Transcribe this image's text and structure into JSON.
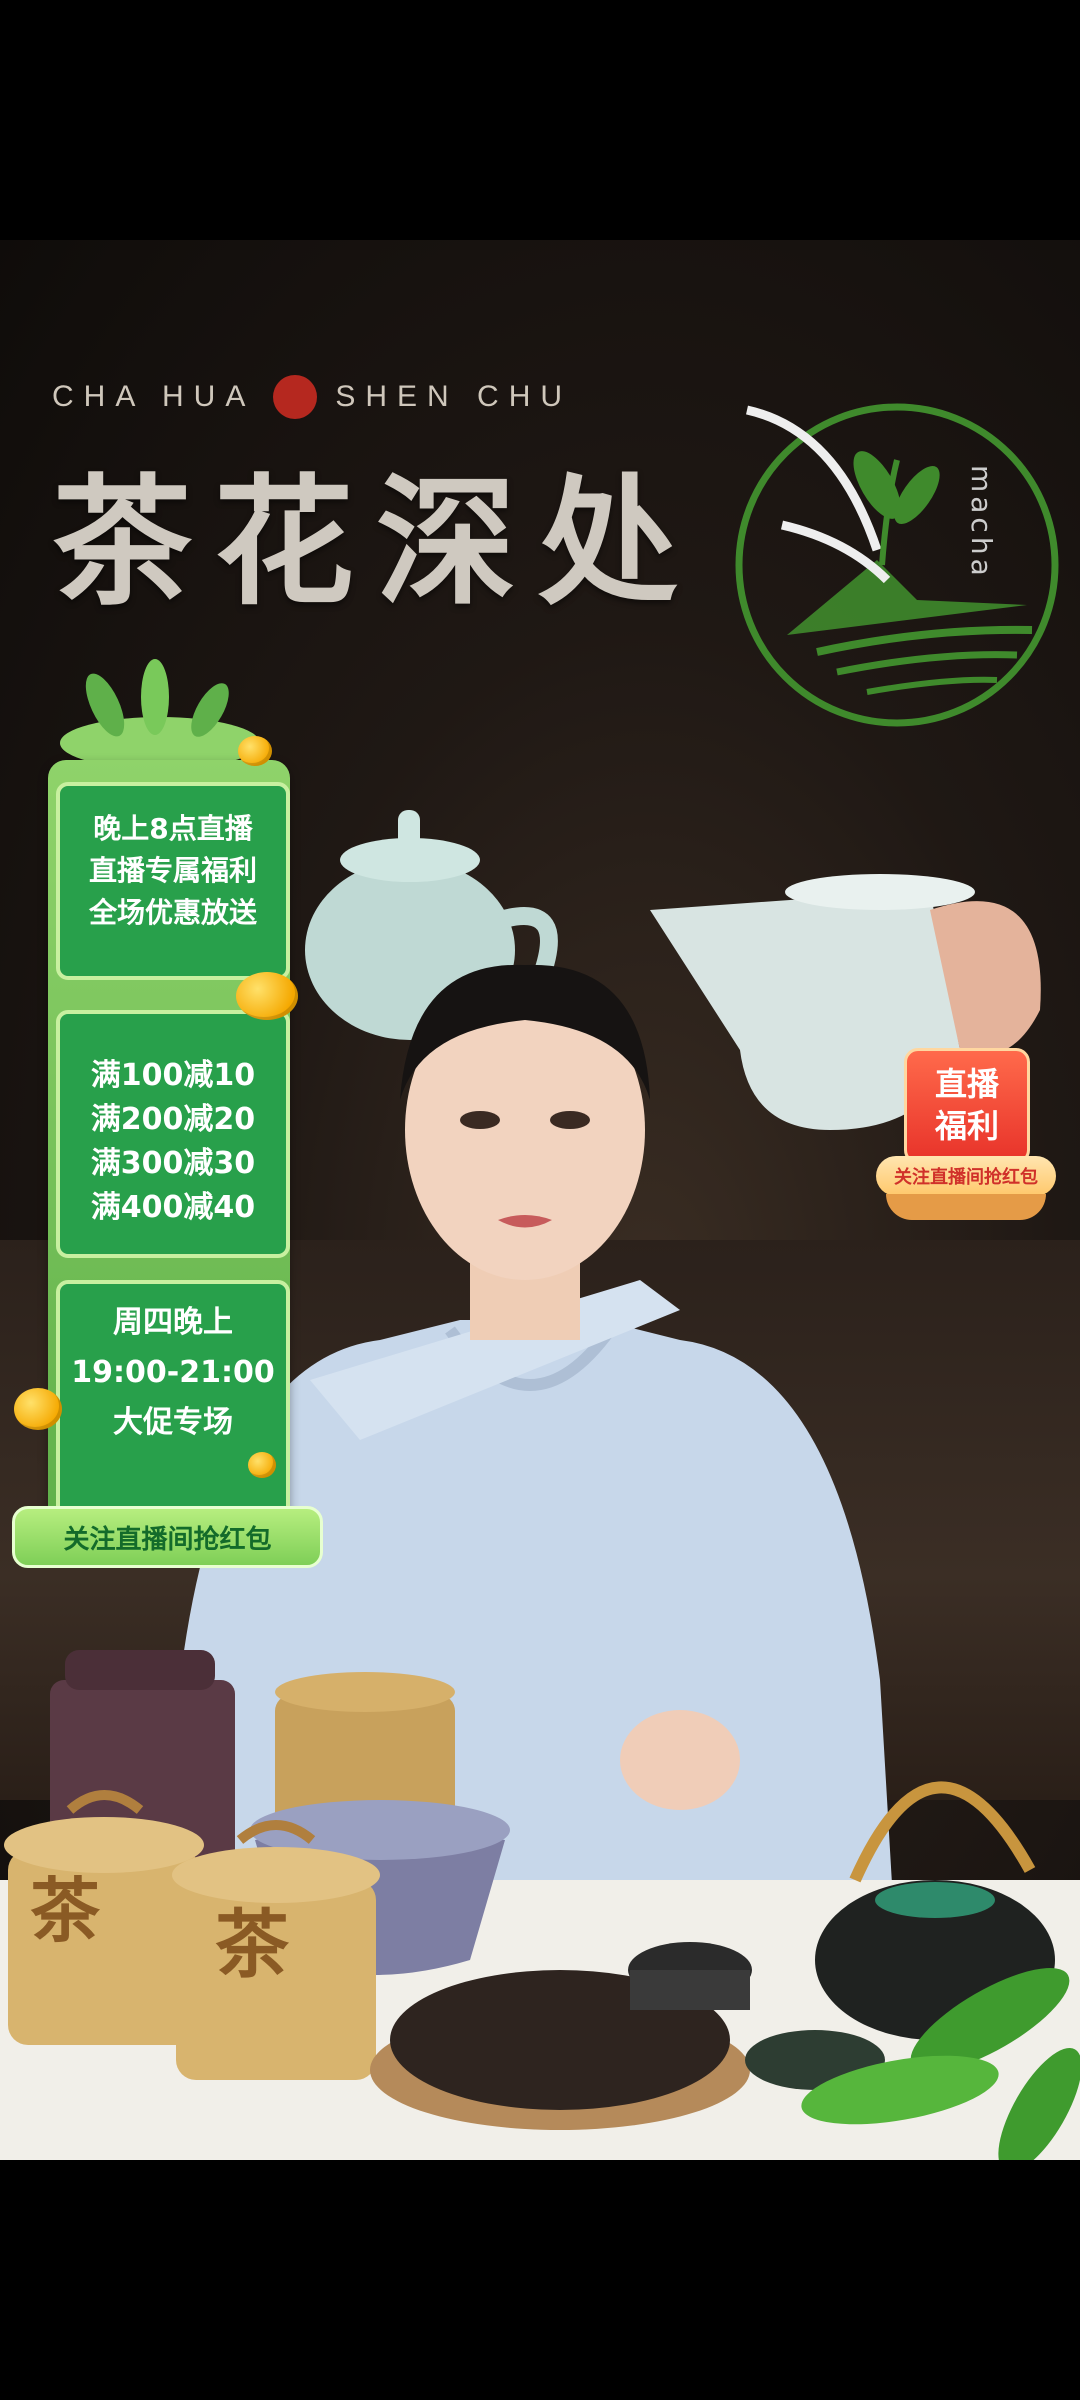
{
  "brand": {
    "subtitle_left": "CHA HUA",
    "subtitle_right": "SHEN CHU",
    "title": "茶花深处",
    "logo_text": "macha"
  },
  "promo": {
    "box1": [
      "晚上8点直播",
      "直播专属福利",
      "全场优惠放送"
    ],
    "box2": [
      "满100减10",
      "满200减20",
      "满300减30",
      "满400减40"
    ],
    "box3": [
      "周四晚上",
      "19:00-21:00",
      "大促专场"
    ],
    "follow": "关注直播间抢红包"
  },
  "live_badge": {
    "line1": "直播",
    "line2": "福利",
    "caption": "关注直播间抢红包"
  },
  "jars": {
    "label": "茶"
  },
  "colors": {
    "promo_green": "#28a04b",
    "panel_light": "#8fd36a",
    "badge_red": "#e8332a",
    "logo_green": "#3f8a2c"
  },
  "icons": [
    "tea-leaf-logo-icon",
    "coin-icon",
    "leaf-decoration-icon"
  ]
}
